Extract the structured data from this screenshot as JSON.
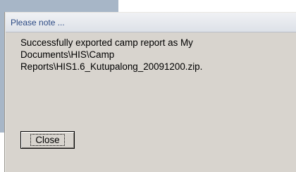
{
  "dialog": {
    "title": "Please note ...",
    "message": "Successfully exported camp report as My\nDocuments\\HIS\\Camp\nReports\\HIS1.6_Kutupalong_20091200.zip.",
    "close_label": "Close"
  },
  "colors": {
    "backdrop": "#a7b6c7",
    "dialog_body": "#d8d4ce",
    "title_text": "#2c4a84"
  }
}
